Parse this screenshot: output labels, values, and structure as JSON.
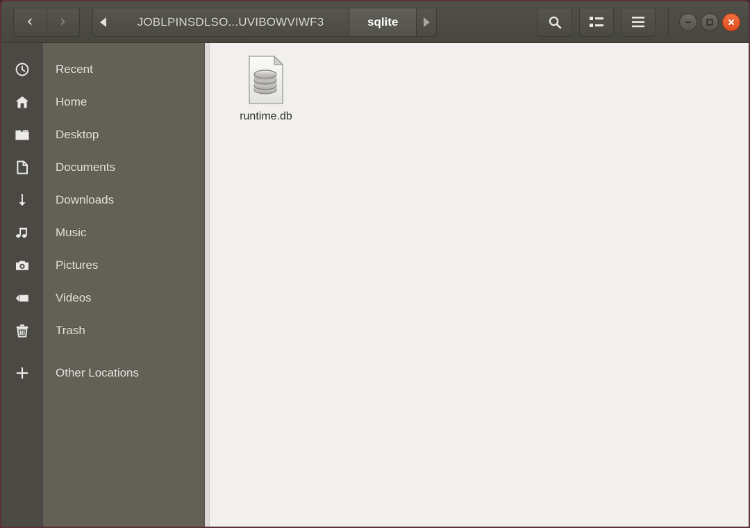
{
  "window": {
    "title": "sqlite",
    "accent_close": "#e8562c",
    "headerbar_bg": "#4b4a44",
    "sidebar_bg": "#636055",
    "iconrail_bg": "#4a4943",
    "content_bg": "#f1f0ee"
  },
  "header": {
    "back_label": "‹",
    "forward_label": "›",
    "breadcrumb": {
      "prev_arrow": "left-arrow",
      "path_label": "JOBLPINSDLSO...UVIBOWVIWF3",
      "current_label": "sqlite",
      "next_arrow": "right-arrow"
    },
    "tools": [
      {
        "name": "search-button",
        "icon": "search-icon"
      },
      {
        "name": "view-options-button",
        "icon": "list-view-icon"
      },
      {
        "name": "menu-button",
        "icon": "hamburger-icon"
      }
    ],
    "window_controls": [
      {
        "name": "minimize-button",
        "icon": "minimize-icon"
      },
      {
        "name": "maximize-button",
        "icon": "maximize-icon"
      },
      {
        "name": "close-button",
        "icon": "close-icon"
      }
    ]
  },
  "sidebar": {
    "items": [
      {
        "label": "Recent",
        "icon": "clock-icon"
      },
      {
        "label": "Home",
        "icon": "home-icon"
      },
      {
        "label": "Desktop",
        "icon": "folder-icon"
      },
      {
        "label": "Documents",
        "icon": "document-icon"
      },
      {
        "label": "Downloads",
        "icon": "download-arrow-icon"
      },
      {
        "label": "Music",
        "icon": "music-note-icon"
      },
      {
        "label": "Pictures",
        "icon": "camera-icon"
      },
      {
        "label": "Videos",
        "icon": "video-camera-icon"
      },
      {
        "label": "Trash",
        "icon": "trash-icon"
      },
      {
        "label": "Other Locations",
        "icon": "plus-icon"
      }
    ]
  },
  "content": {
    "files": [
      {
        "name": "runtime.db",
        "icon": "database-file-icon"
      }
    ]
  }
}
